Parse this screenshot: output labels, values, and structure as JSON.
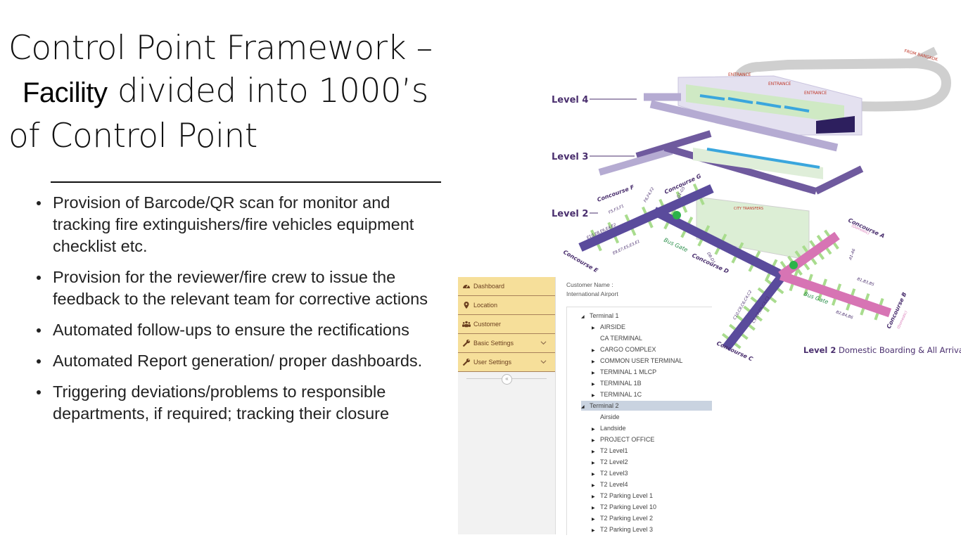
{
  "title": {
    "line1": "Control Point Framework –",
    "facility": "Facility",
    "line2_rest": " divided into 1000’s",
    "line3": "of Control Point"
  },
  "bullets": [
    "Provision of Barcode/QR scan for monitor and tracking fire extinguishers/fire vehicles equipment checklist etc.",
    "Provision for the reviewer/fire crew to issue the feedback to the relevant team for corrective actions",
    "Automated follow-ups to ensure the rectifications",
    "Automated Report generation/ proper dashboards.",
    "Triggering deviations/problems to responsible departments, if required; tracking their closure"
  ],
  "app": {
    "sidebar": [
      {
        "label": "Dashboard",
        "icon": "dashboard-gauge-icon"
      },
      {
        "label": "Location",
        "icon": "map-pin-icon"
      },
      {
        "label": "Customer",
        "icon": "users-icon"
      },
      {
        "label": "Basic Settings",
        "icon": "wrench-icon",
        "expandable": true
      },
      {
        "label": "User Settings",
        "icon": "wrench-icon",
        "expandable": true
      }
    ],
    "collapse_label": "«",
    "customer_label": "Customer Name :",
    "customer_value": "International Airport",
    "tree": [
      {
        "label": "Terminal 1",
        "level": 0,
        "state": "expanded"
      },
      {
        "label": "AIRSIDE",
        "level": 1,
        "state": "collapsed"
      },
      {
        "label": "CA TERMINAL",
        "level": 1,
        "state": "leaf"
      },
      {
        "label": "CARGO COMPLEX",
        "level": 1,
        "state": "collapsed"
      },
      {
        "label": "COMMON USER TERMINAL",
        "level": 1,
        "state": "collapsed"
      },
      {
        "label": "TERMINAL 1 MLCP",
        "level": 1,
        "state": "collapsed"
      },
      {
        "label": "TERMINAL 1B",
        "level": 1,
        "state": "collapsed"
      },
      {
        "label": "TERMINAL 1C",
        "level": 1,
        "state": "collapsed"
      },
      {
        "label": "Terminal 2",
        "level": 0,
        "state": "expanded",
        "selected": true
      },
      {
        "label": "Airside",
        "level": 1,
        "state": "leaf"
      },
      {
        "label": "Landside",
        "level": 1,
        "state": "collapsed"
      },
      {
        "label": "PROJECT OFFICE",
        "level": 1,
        "state": "collapsed"
      },
      {
        "label": "T2 Level1",
        "level": 1,
        "state": "collapsed"
      },
      {
        "label": "T2 Level2",
        "level": 1,
        "state": "collapsed"
      },
      {
        "label": "T2 Level3",
        "level": 1,
        "state": "collapsed"
      },
      {
        "label": "T2 Level4",
        "level": 1,
        "state": "collapsed"
      },
      {
        "label": "T2 Parking Level 1",
        "level": 1,
        "state": "collapsed"
      },
      {
        "label": "T2 Parking Level 10",
        "level": 1,
        "state": "collapsed"
      },
      {
        "label": "T2 Parking Level 2",
        "level": 1,
        "state": "collapsed"
      },
      {
        "label": "T2 Parking Level 3",
        "level": 1,
        "state": "collapsed"
      }
    ]
  },
  "map": {
    "level4": "Level 4",
    "level3": "Level 3",
    "level2": "Level 2",
    "from_bangkok": "FROM BANGKOK",
    "entrance": "ENTRANCE",
    "city_transfers": "CITY TRANSFERS",
    "bus_gate": "Bus Gate",
    "concourse_a": "Concourse A",
    "concourse_b": "Concourse B",
    "concourse_c": "Concourse C",
    "concourse_d": "Concourse D",
    "concourse_e": "Concourse E",
    "concourse_f": "Concourse F",
    "concourse_g": "Concourse G",
    "domestic": "(Domestic)",
    "gates": {
      "a": "A1-A6",
      "b_top": "B1,B3,B5",
      "b_bottom": "B2,B4,B6",
      "c_top": "C10,C8,C6,C4,C2",
      "c_bottom": "C9,C7,C5,C3,C1",
      "d": "D8-D1",
      "e_top": "E10,E8,E6,E4,E2",
      "e_bottom": "E9,E7,E5,E3,E1",
      "f_top": "F6,F4,F2",
      "f_bottom": "F5,F3,F1",
      "g": "G1-G5"
    },
    "caption_bold": "Level 2",
    "caption_rest": " Domestic Boarding & All Arrival",
    "colors": {
      "concourse": "#5a4b9c",
      "domestic": "#d774b4",
      "gate": "#a9dc8e",
      "level4": "#b5abd2",
      "road": "#cfcfcf",
      "label": "#4a2f6e"
    }
  }
}
